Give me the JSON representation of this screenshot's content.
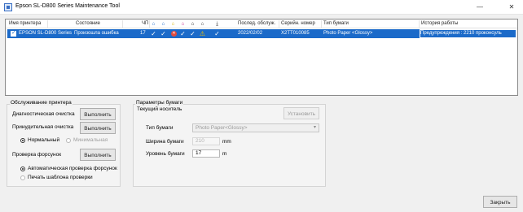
{
  "window": {
    "title": "Epson SL-D800 Series Maintenance Tool",
    "minimize_glyph": "—",
    "close_glyph": "✕"
  },
  "table": {
    "columns": [
      "Имя принтера",
      "Состояние",
      "ЧП",
      "Послед. обслуж.",
      "Серийн. номер",
      "Тип бумаги",
      "История работы"
    ],
    "status_icons": [
      "check-icon",
      "check-icon",
      "error-icon",
      "check-icon",
      "check-icon",
      "warning-icon",
      "check-icon"
    ],
    "row": {
      "printer_name": "EPSON SL-D800 Series",
      "state": "Произошла ошибка",
      "cp": "17",
      "last_service": "2022/02/02",
      "serial": "X2TT010085",
      "paper_type": "Photo Paper <Glossy>",
      "history": "Предупреждения : 2210 проконсуль"
    }
  },
  "cleaning": {
    "title": "Обслуживание принтера",
    "head_clean_label": "Диагностическая очистка",
    "head_clean_button": "Выполнить",
    "forced_clean_label": "Принудительная очистка",
    "forced_clean_button": "Выполнить",
    "radio_normal": "Нормальный",
    "radio_minimal": "Минимальная",
    "nozzle_check_label": "Проверка форсунок",
    "nozzle_check_button": "Выполнить",
    "radio_auto": "Автоматическая проверка форсунок",
    "radio_print": "Печать шаблона проверки"
  },
  "paper": {
    "title": "Параметры бумаги",
    "current_label": "Текущий носитель",
    "set_button": "Установить",
    "type_label": "Тип бумаги",
    "type_value": "Photo Paper<Glossy>",
    "width_label": "Ширина бумаги",
    "width_value": "210",
    "width_unit": "mm",
    "remaining_label": "Уровень бумаги",
    "remaining_value": "17",
    "remaining_unit": "m"
  },
  "footer": {
    "close_button": "Закрыть"
  }
}
